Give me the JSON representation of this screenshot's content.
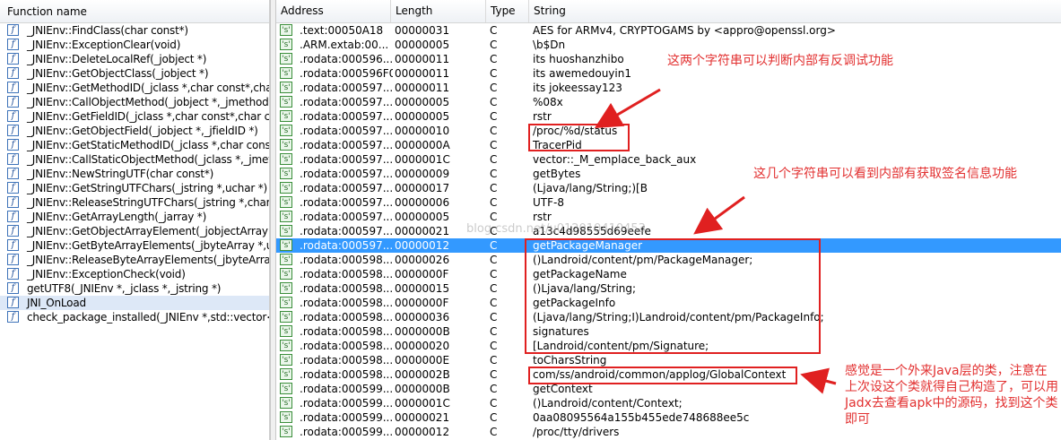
{
  "functions_panel": {
    "header": "Function name",
    "items": [
      {
        "label": "_JNIEnv::FindClass(char const*)"
      },
      {
        "label": "_JNIEnv::ExceptionClear(void)"
      },
      {
        "label": "_JNIEnv::DeleteLocalRef(_jobject *)"
      },
      {
        "label": "_JNIEnv::GetObjectClass(_jobject *)"
      },
      {
        "label": "_JNIEnv::GetMethodID(_jclass *,char const*,cha"
      },
      {
        "label": "_JNIEnv::CallObjectMethod(_jobject *,_jmethodI"
      },
      {
        "label": "_JNIEnv::GetFieldID(_jclass *,char const*,char co"
      },
      {
        "label": "_JNIEnv::GetObjectField(_jobject *,_jfieldID *)"
      },
      {
        "label": "_JNIEnv::GetStaticMethodID(_jclass *,char const"
      },
      {
        "label": "_JNIEnv::CallStaticObjectMethod(_jclass *,_jmeth"
      },
      {
        "label": "_JNIEnv::NewStringUTF(char const*)"
      },
      {
        "label": "_JNIEnv::GetStringUTFChars(_jstring *,uchar *)"
      },
      {
        "label": "_JNIEnv::ReleaseStringUTFChars(_jstring *,char c"
      },
      {
        "label": "_JNIEnv::GetArrayLength(_jarray *)"
      },
      {
        "label": "_JNIEnv::GetObjectArrayElement(_jobjectArray *"
      },
      {
        "label": "_JNIEnv::GetByteArrayElements(_jbyteArray *,uc"
      },
      {
        "label": "_JNIEnv::ReleaseByteArrayElements(_jbyteArray"
      },
      {
        "label": "_JNIEnv::ExceptionCheck(void)"
      },
      {
        "label": "getUTF8(_JNIEnv *,_jclass *,_jstring *)"
      },
      {
        "label": "JNI_OnLoad"
      },
      {
        "label": "check_package_installed(_JNIEnv *,std::vector<"
      }
    ],
    "icon_glyph": "f"
  },
  "strings_table": {
    "headers": {
      "address": "Address",
      "length": "Length",
      "type": "Type",
      "string": "String"
    },
    "row_icon_glyph": "'s'",
    "rows": [
      {
        "address": ".text:00050A18",
        "length": "00000031",
        "type": "C",
        "string": "AES for ARMv4, CRYPTOGAMS by <appro@openssl.org>"
      },
      {
        "address": ".ARM.extab:00...",
        "length": "00000005",
        "type": "C",
        "string": "\\b$Dn"
      },
      {
        "address": ".rodata:000596...",
        "length": "00000011",
        "type": "C",
        "string": "its huoshanzhibo"
      },
      {
        "address": ".rodata:000596F0",
        "length": "00000011",
        "type": "C",
        "string": "its awemedouyin1"
      },
      {
        "address": ".rodata:000597...",
        "length": "00000011",
        "type": "C",
        "string": "its jokeessay123"
      },
      {
        "address": ".rodata:000597...",
        "length": "00000005",
        "type": "C",
        "string": "%08x"
      },
      {
        "address": ".rodata:000597...",
        "length": "00000005",
        "type": "C",
        "string": "rstr"
      },
      {
        "address": ".rodata:000597...",
        "length": "00000010",
        "type": "C",
        "string": "/proc/%d/status"
      },
      {
        "address": ".rodata:000597...",
        "length": "0000000A",
        "type": "C",
        "string": "TracerPid"
      },
      {
        "address": ".rodata:000597...",
        "length": "0000001C",
        "type": "C",
        "string": "vector::_M_emplace_back_aux"
      },
      {
        "address": ".rodata:000597...",
        "length": "00000009",
        "type": "C",
        "string": "getBytes"
      },
      {
        "address": ".rodata:000597...",
        "length": "00000017",
        "type": "C",
        "string": "(Ljava/lang/String;)[B"
      },
      {
        "address": ".rodata:000597...",
        "length": "00000006",
        "type": "C",
        "string": "UTF-8"
      },
      {
        "address": ".rodata:000597...",
        "length": "00000005",
        "type": "C",
        "string": "rstr"
      },
      {
        "address": ".rodata:000597...",
        "length": "00000021",
        "type": "C",
        "string": "a13c4d98555d69eefe"
      },
      {
        "address": ".rodata:000597...",
        "length": "00000012",
        "type": "C",
        "string": "getPackageManager",
        "selected": true
      },
      {
        "address": ".rodata:000598...",
        "length": "00000026",
        "type": "C",
        "string": "()Landroid/content/pm/PackageManager;"
      },
      {
        "address": ".rodata:000598...",
        "length": "0000000F",
        "type": "C",
        "string": "getPackageName"
      },
      {
        "address": ".rodata:000598...",
        "length": "00000015",
        "type": "C",
        "string": "()Ljava/lang/String;"
      },
      {
        "address": ".rodata:000598...",
        "length": "0000000F",
        "type": "C",
        "string": "getPackageInfo"
      },
      {
        "address": ".rodata:000598...",
        "length": "00000036",
        "type": "C",
        "string": "(Ljava/lang/String;I)Landroid/content/pm/PackageInfo;"
      },
      {
        "address": ".rodata:000598...",
        "length": "0000000B",
        "type": "C",
        "string": "signatures"
      },
      {
        "address": ".rodata:000598...",
        "length": "00000020",
        "type": "C",
        "string": "[Landroid/content/pm/Signature;"
      },
      {
        "address": ".rodata:000598...",
        "length": "0000000E",
        "type": "C",
        "string": "toCharsString"
      },
      {
        "address": ".rodata:000598...",
        "length": "0000002B",
        "type": "C",
        "string": "com/ss/android/common/applog/GlobalContext"
      },
      {
        "address": ".rodata:000599...",
        "length": "0000000B",
        "type": "C",
        "string": "getContext"
      },
      {
        "address": ".rodata:000599...",
        "length": "0000001C",
        "type": "C",
        "string": "()Landroid/content/Context;"
      },
      {
        "address": ".rodata:000599...",
        "length": "00000021",
        "type": "C",
        "string": "0aa08095564a155b455ede748688ee5c"
      },
      {
        "address": ".rodata:000599...",
        "length": "00000012",
        "type": "C",
        "string": "/proc/tty/drivers"
      }
    ]
  },
  "annotations": {
    "anti_debug_note": "这两个字符串可以判断内部有反调试功能",
    "signature_note": "这几个字符串可以看到内部有获取签名信息功能",
    "java_class_note": "感觉是一个外来Java层的类，注意在上次设这个类就得自己构造了，可以用Jadx去查看apk中的源码，找到这个类即可",
    "watermark": "blog.csdn.net/u012010410453"
  },
  "colors": {
    "selection": "#3399ff",
    "annotation_red": "#e02020"
  }
}
